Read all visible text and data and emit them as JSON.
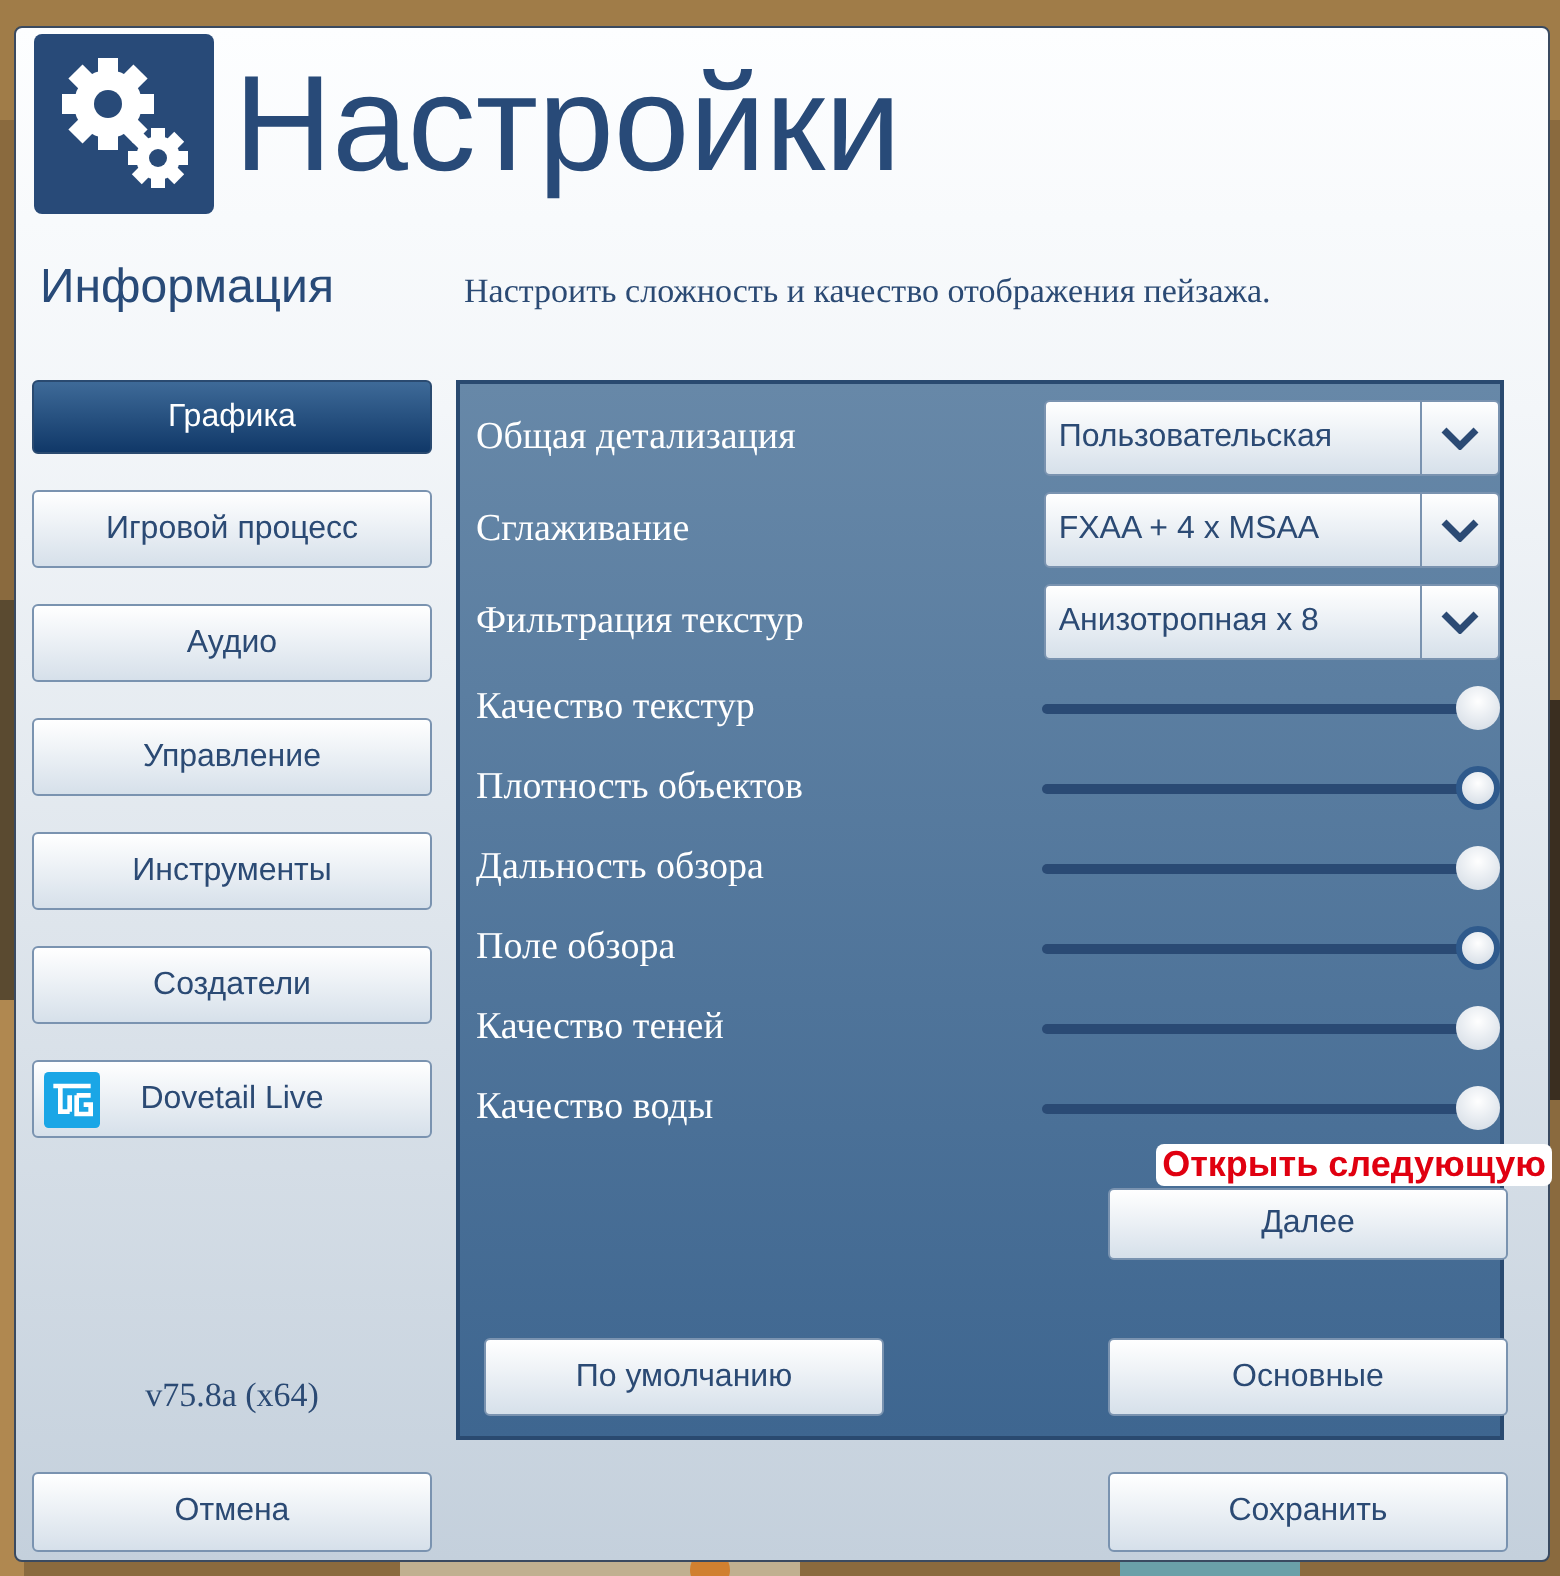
{
  "window": {
    "title": "Настройки"
  },
  "section": {
    "title": "Информация",
    "description": "Настроить сложность и качество отображения пейзажа."
  },
  "sidebar": {
    "items": [
      {
        "label": "Графика",
        "selected": true,
        "kind": "plain"
      },
      {
        "label": "Игровой процесс",
        "selected": false,
        "kind": "plain"
      },
      {
        "label": "Аудио",
        "selected": false,
        "kind": "plain"
      },
      {
        "label": "Управление",
        "selected": false,
        "kind": "plain"
      },
      {
        "label": "Инструменты",
        "selected": false,
        "kind": "plain"
      },
      {
        "label": "Создатели",
        "selected": false,
        "kind": "plain"
      },
      {
        "label": "Dovetail Live",
        "selected": false,
        "kind": "logo"
      }
    ],
    "version": "v75.8a (x64)"
  },
  "settings": [
    {
      "kind": "dropdown",
      "label": "Общая детализация",
      "value": "Пользовательская"
    },
    {
      "kind": "dropdown",
      "label": "Сглаживание",
      "value": "FXAA + 4 x MSAA"
    },
    {
      "kind": "dropdown",
      "label": "Фильтрация текстур",
      "value": "Анизотропная x 8"
    },
    {
      "kind": "slider",
      "label": "Качество текстур",
      "level": 1,
      "focused": false
    },
    {
      "kind": "slider",
      "label": "Плотность объектов",
      "level": 1,
      "focused": true
    },
    {
      "kind": "slider",
      "label": "Дальность обзора",
      "level": 1,
      "focused": false
    },
    {
      "kind": "slider",
      "label": "Поле обзора",
      "level": 1,
      "focused": true
    },
    {
      "kind": "slider",
      "label": "Качество теней",
      "level": 1,
      "focused": false
    },
    {
      "kind": "slider",
      "label": "Качество воды",
      "level": 1,
      "focused": false
    }
  ],
  "annotation": "Открыть следующую",
  "panel_buttons": {
    "next": "Далее",
    "defaults": "По умолчанию",
    "basic": "Основные"
  },
  "footer": {
    "cancel": "Отмена",
    "save": "Сохранить"
  }
}
